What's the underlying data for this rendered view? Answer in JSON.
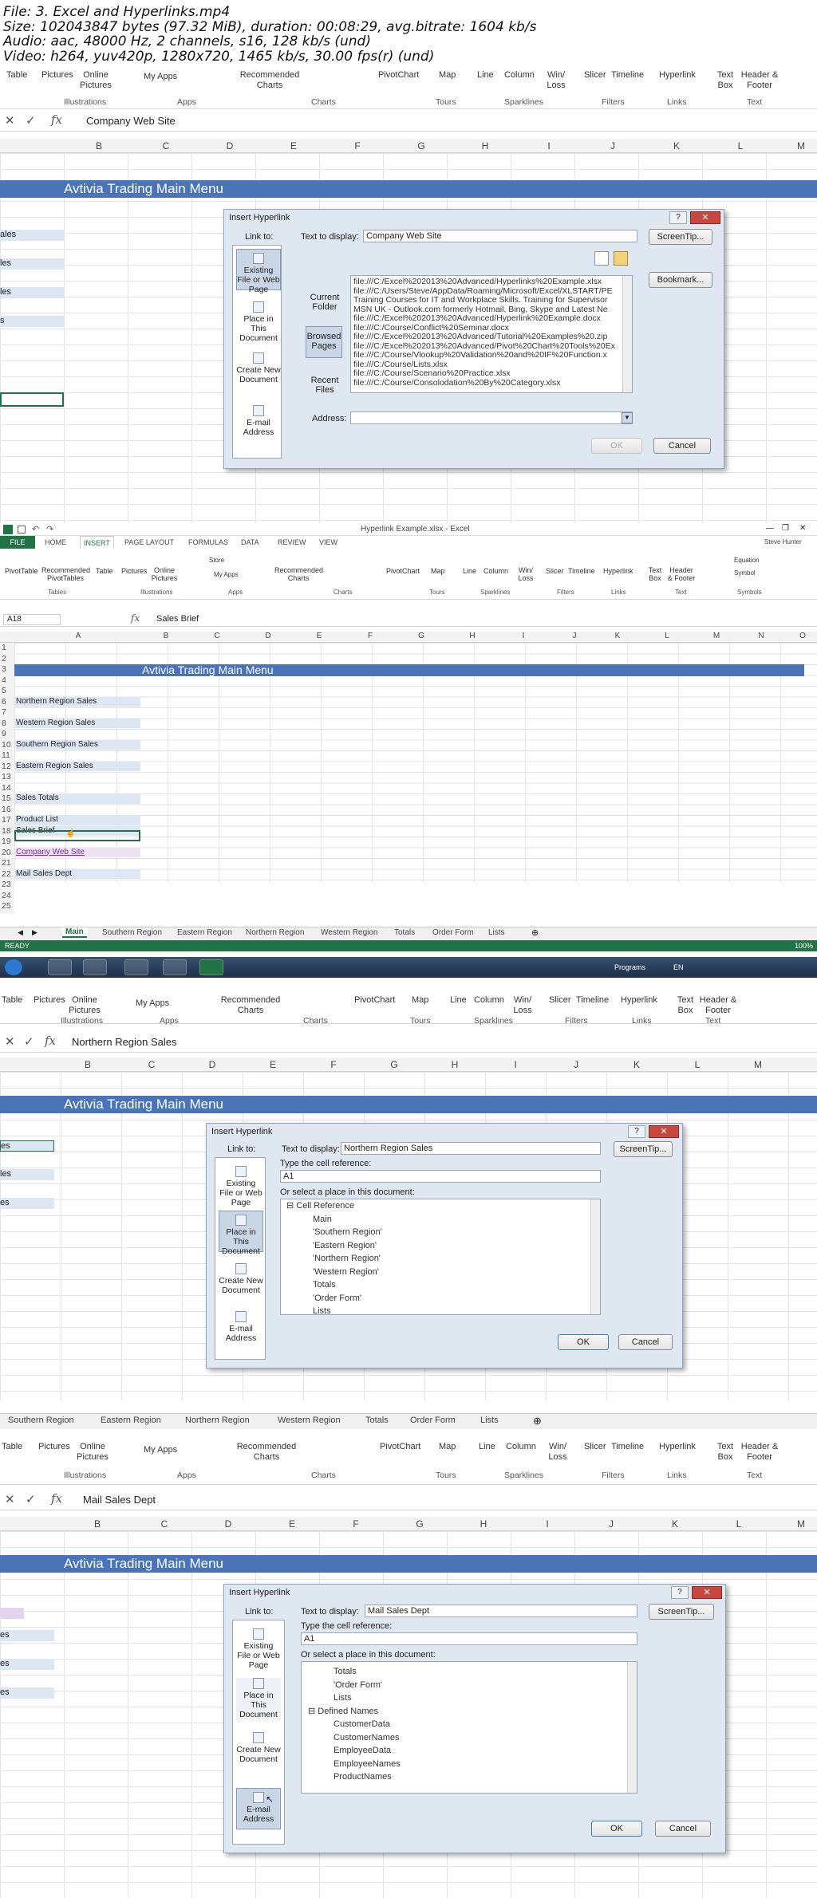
{
  "header": {
    "lines": [
      "File: 3. Excel and Hyperlinks.mp4",
      "Size: 102043847 bytes (97.32 MiB), duration: 00:08:29, avg.bitrate: 1604 kb/s",
      "Audio: aac, 48000 Hz, 2 channels, s16, 128 kb/s (und)",
      "Video: h264, yuv420p, 1280x720, 1465 kb/s, 30.00 fps(r) (und)"
    ]
  },
  "ribbon": {
    "items": [
      "Table",
      "Pictures",
      "Online Pictures",
      "My Apps",
      "Recommended Charts",
      "PivotChart",
      "Map",
      "Line",
      "Column",
      "Win/ Loss",
      "Slicer",
      "Timeline",
      "Hyperlink",
      "Text Box",
      "Header & Footer"
    ],
    "groups": [
      "Illustrations",
      "Apps",
      "Charts",
      "Tours",
      "Sparklines",
      "Filters",
      "Links",
      "Text"
    ]
  },
  "columns": [
    "B",
    "C",
    "D",
    "E",
    "F",
    "G",
    "H",
    "I",
    "J",
    "K",
    "L",
    "M"
  ],
  "menu_title": "Avtivia Trading Main Menu",
  "dialog_title": "Insert Hyperlink",
  "dialog_common": {
    "link_to": "Link to:",
    "text_to_display": "Text to display:",
    "screentip": "ScreenTip...",
    "ok": "OK",
    "cancel": "Cancel",
    "existing_file": "Existing File or Web Page",
    "place_in_doc": "Place in This Document",
    "create_new": "Create New Document",
    "email": "E-mail Address",
    "type_cell_ref": "Type the cell reference:",
    "or_select": "Or select a place in this document:"
  },
  "shot1": {
    "formula": "Company Web Site",
    "display_text": "Company Web Site",
    "bookmark": "Bookmark...",
    "current_folder": "Current Folder",
    "browsed_pages": "Browsed Pages",
    "recent_files": "Recent Files",
    "address_label": "Address:",
    "left_labels": [
      "ales",
      "les",
      "les",
      "s"
    ],
    "files": [
      "file:///C:/Excel%202013%20Advanced/Hyperlinks%20Example.xlsx",
      "file:///C:/Users/Steve/AppData/Roaming/Microsoft/Excel/XLSTART/PE",
      "Training Courses for IT and Workplace Skills. Training for Supervisor",
      "MSN UK - Outlook.com formerly Hotmail, Bing, Skype and Latest Ne",
      "file:///C:/Excel%202013%20Advanced/Hyperlink%20Example.docx",
      "file:///C:/Course/Conflict%20Seminar.docx",
      "file:///C:/Excel%202013%20Advanced/Tutorial%20Examples%20.zip",
      "file:///C:/Excel%202013%20Advanced/Pivot%20Chart%20Tools%20Ex",
      "file:///C:/Course/Vlookup%20Validation%20and%20IF%20Function.x",
      "file:///C:/Course/Lists.xlsx",
      "file:///C:/Course/Scenario%20Practice.xlsx",
      "file:///C:/Course/Consolodation%20By%20Category.xlsx"
    ]
  },
  "shot2": {
    "window_title": "Hyperlink Example.xlsx - Excel",
    "user": "Steve Hunter",
    "tabs": [
      "FILE",
      "HOME",
      "INSERT",
      "PAGE LAYOUT",
      "FORMULAS",
      "DATA",
      "REVIEW",
      "VIEW"
    ],
    "ribbon_items": [
      "PivotTable",
      "Recommended PivotTables",
      "Table",
      "Pictures",
      "Online Pictures",
      "Store",
      "My Apps",
      "Recommended Charts",
      "PivotChart",
      "Map",
      "Line",
      "Column",
      "Win/ Loss",
      "Slicer",
      "Timeline",
      "Hyperlink",
      "Text Box",
      "Header & Footer",
      "Equation",
      "Symbol"
    ],
    "ribbon_groups": [
      "Tables",
      "Illustrations",
      "Apps",
      "Charts",
      "Tours",
      "Sparklines",
      "Filters",
      "Links",
      "Text",
      "Symbols"
    ],
    "namebox": "A18",
    "formula": "Sales Brief",
    "columns": [
      "A",
      "B",
      "C",
      "D",
      "E",
      "F",
      "G",
      "H",
      "I",
      "J",
      "K",
      "L",
      "M",
      "N",
      "O"
    ],
    "rows": [
      {
        "n": "1",
        "t": ""
      },
      {
        "n": "2",
        "t": ""
      },
      {
        "n": "3",
        "t": ""
      },
      {
        "n": "4",
        "t": ""
      },
      {
        "n": "5",
        "t": ""
      },
      {
        "n": "6",
        "t": "Northern Region Sales"
      },
      {
        "n": "7",
        "t": ""
      },
      {
        "n": "8",
        "t": "Western Region Sales"
      },
      {
        "n": "9",
        "t": ""
      },
      {
        "n": "10",
        "t": "Southern Region Sales"
      },
      {
        "n": "11",
        "t": ""
      },
      {
        "n": "12",
        "t": "Eastern Region Sales"
      },
      {
        "n": "13",
        "t": ""
      },
      {
        "n": "14",
        "t": ""
      },
      {
        "n": "15",
        "t": "Sales Totals"
      },
      {
        "n": "16",
        "t": ""
      },
      {
        "n": "17",
        "t": "Product List"
      },
      {
        "n": "18",
        "t": "Sales Brief"
      },
      {
        "n": "19",
        "t": ""
      },
      {
        "n": "20",
        "t": "Company Web Site"
      },
      {
        "n": "21",
        "t": ""
      },
      {
        "n": "22",
        "t": "Mail Sales Dept"
      },
      {
        "n": "23",
        "t": ""
      },
      {
        "n": "24",
        "t": ""
      },
      {
        "n": "25",
        "t": ""
      }
    ],
    "sheet_tabs": [
      "Main",
      "Southern Region",
      "Eastern Region",
      "Northern Region",
      "Western Region",
      "Totals",
      "Order Form",
      "Lists"
    ],
    "status": "READY",
    "zoom": "100%",
    "tray": [
      "Programs",
      "EN"
    ]
  },
  "shot3": {
    "formula": "Northern Region Sales",
    "display_text": "Northern Region Sales",
    "cell_ref": "A1",
    "tree": [
      "Cell Reference",
      "Main",
      "'Southern Region'",
      "'Eastern Region'",
      "'Northern Region'",
      "'Western Region'",
      "Totals",
      "'Order Form'",
      "Lists"
    ],
    "sheet_tabs": [
      "Southern Region",
      "Eastern Region",
      "Northern Region",
      "Western Region",
      "Totals",
      "Order Form",
      "Lists"
    ],
    "left_labels": [
      "es",
      "les",
      "es"
    ]
  },
  "shot4": {
    "formula": "Mail Sales Dept",
    "display_text": "Mail Sales Dept",
    "cell_ref": "A1",
    "tree": [
      "Totals",
      "'Order Form'",
      "Lists",
      "Defined Names",
      "CustomerData",
      "CustomerNames",
      "EmployeeData",
      "EmployeeNames",
      "ProductNames"
    ],
    "left_labels": [
      "es",
      "es",
      "es"
    ]
  },
  "colors": {
    "accent": "#4a73b8",
    "excel_green": "#217346",
    "close_red": "#c9473f"
  }
}
